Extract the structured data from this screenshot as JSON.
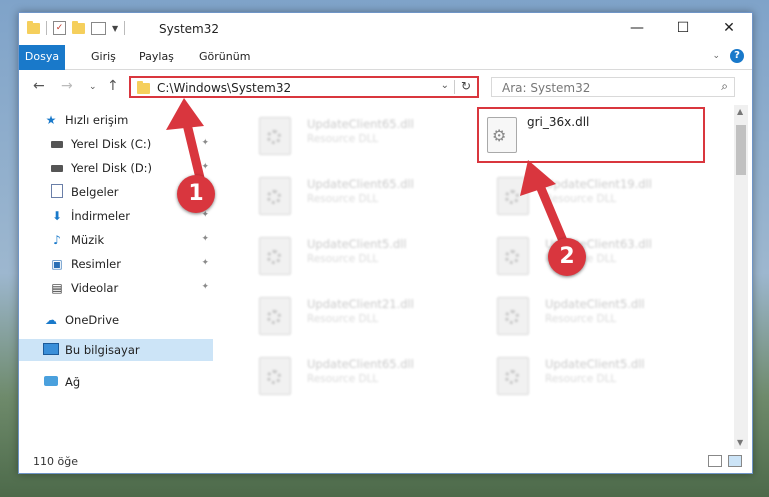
{
  "window": {
    "title": "System32",
    "controls": {
      "minimize": "—",
      "maximize": "☐",
      "close": "✕"
    }
  },
  "ribbon": {
    "tabs": [
      "Dosya",
      "Giriş",
      "Paylaş",
      "Görünüm"
    ],
    "help": "?",
    "expand": "⌄"
  },
  "nav": {
    "address": "C:\\Windows\\System32",
    "search_placeholder": "Ara: System32",
    "back": "←",
    "forward": "→",
    "recent": "⌄",
    "up": "↑",
    "refresh": "↻",
    "address_dropdown": "⌄",
    "search_icon": "⌕"
  },
  "sidebar": {
    "items": [
      {
        "label": "Hızlı erişim",
        "icon": "star-icon",
        "glyph": "★",
        "color": "#1979ca"
      },
      {
        "label": "Yerel Disk (C:)",
        "icon": "drive-icon",
        "pinned": true
      },
      {
        "label": "Yerel Disk (D:)",
        "icon": "drive-icon",
        "pinned": true
      },
      {
        "label": "Belgeler",
        "icon": "document-icon",
        "pinned": true
      },
      {
        "label": "İndirmeler",
        "icon": "download-icon",
        "glyph": "⬇",
        "color": "#1979ca",
        "pinned": true
      },
      {
        "label": "Müzik",
        "icon": "music-icon",
        "glyph": "♪",
        "color": "#1979ca",
        "pinned": true
      },
      {
        "label": "Resimler",
        "icon": "pictures-icon",
        "glyph": "▣",
        "color": "#2b6fb5",
        "pinned": true
      },
      {
        "label": "Videolar",
        "icon": "video-icon",
        "glyph": "▤",
        "color": "#333",
        "pinned": true
      },
      {
        "label": "OneDrive",
        "icon": "cloud-icon",
        "glyph": "☁",
        "color": "#1979ca"
      },
      {
        "label": "Bu bilgisayar",
        "icon": "computer-icon",
        "selected": true
      },
      {
        "label": "Ağ",
        "icon": "network-icon"
      }
    ],
    "pin_glyph": "📌"
  },
  "files": {
    "left_column": [
      {
        "name": "UpdateClient65.dll",
        "type": "Resource DLL"
      },
      {
        "name": "UpdateClient65.dll",
        "type": "Resource DLL"
      },
      {
        "name": "UpdateClient5.dll",
        "type": "Resource DLL"
      },
      {
        "name": "UpdateClient21.dll",
        "type": "Resource DLL"
      },
      {
        "name": "UpdateClient65.dll",
        "type": "Resource DLL"
      }
    ],
    "right_column": [
      {
        "name": "UpdateClient19.dll",
        "type": "Resource DLL"
      },
      {
        "name": "UpdateClient63.dll",
        "type": "Resource DLL"
      },
      {
        "name": "UpdateClient5.dll",
        "type": "Resource DLL"
      },
      {
        "name": "UpdateClient5.dll",
        "type": "Resource DLL"
      }
    ],
    "highlighted": {
      "name": "gri_36x.dll"
    }
  },
  "status": {
    "count": "110 öğe"
  },
  "annotations": {
    "step1": "1",
    "step2": "2",
    "color": "#d9363e"
  }
}
